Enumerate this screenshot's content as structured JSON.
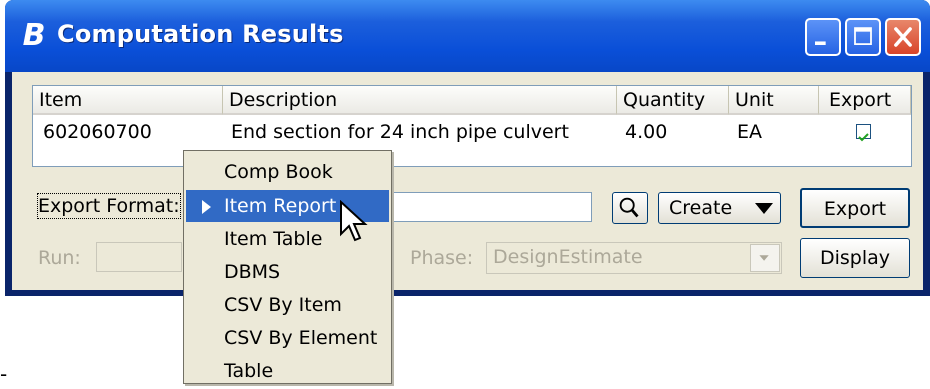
{
  "window": {
    "title": "Computation Results",
    "icon": "bentley-b-icon"
  },
  "list": {
    "columns": [
      "Item",
      "Description",
      "Quantity",
      "Unit",
      "Export"
    ],
    "rows": [
      {
        "item": "602060700",
        "description": "End section for 24 inch pipe culvert",
        "quantity": "4.00",
        "unit": "EA",
        "export": true
      }
    ]
  },
  "export_format": {
    "label": "Export Format:",
    "value": ""
  },
  "buttons": {
    "create": "Create",
    "export": "Export",
    "display": "Display"
  },
  "run": {
    "label": "Run:",
    "value": ""
  },
  "phase": {
    "label": "Phase:",
    "value": "DesignEstimate"
  },
  "menu": {
    "items": [
      "Comp Book",
      "Item Report",
      "Item Table",
      "DBMS",
      "CSV By Item",
      "CSV By Element",
      "Table"
    ],
    "selected_index": 1
  },
  "footer_mark": "-",
  "colors": {
    "titlebar": "#0a4fd8",
    "selection": "#316ac5",
    "face": "#ece9d8"
  }
}
